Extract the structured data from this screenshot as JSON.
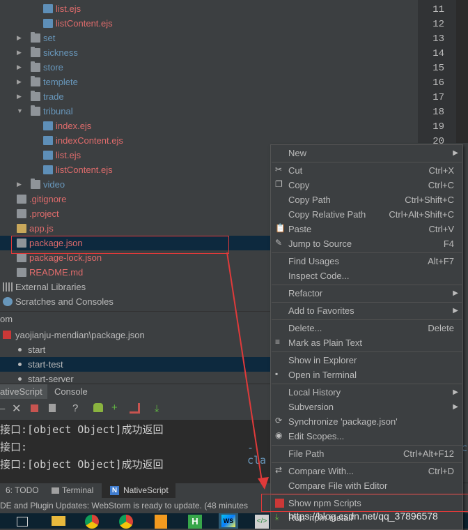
{
  "colors": {
    "accent_red": "#e03a3a",
    "selection": "#0d293e",
    "menu_bg": "#3c3f41"
  },
  "tree": {
    "items": [
      {
        "label": "list.ejs",
        "kind": "ejs",
        "indent": 3,
        "color": "red"
      },
      {
        "label": "listContent.ejs",
        "kind": "ejs",
        "indent": 3,
        "color": "red"
      },
      {
        "label": "set",
        "kind": "folder",
        "indent": 2,
        "color": "blue",
        "arrow": "▶"
      },
      {
        "label": "sickness",
        "kind": "folder",
        "indent": 2,
        "color": "blue",
        "arrow": "▶"
      },
      {
        "label": "store",
        "kind": "folder",
        "indent": 2,
        "color": "blue",
        "arrow": "▶"
      },
      {
        "label": "templete",
        "kind": "folder",
        "indent": 2,
        "color": "blue",
        "arrow": "▶"
      },
      {
        "label": "trade",
        "kind": "folder",
        "indent": 2,
        "color": "blue",
        "arrow": "▶"
      },
      {
        "label": "tribunal",
        "kind": "folder",
        "indent": 2,
        "color": "blue",
        "arrow": "▼"
      },
      {
        "label": "index.ejs",
        "kind": "ejs",
        "indent": 3,
        "color": "red"
      },
      {
        "label": "indexContent.ejs",
        "kind": "ejs",
        "indent": 3,
        "color": "red"
      },
      {
        "label": "list.ejs",
        "kind": "ejs",
        "indent": 3,
        "color": "red"
      },
      {
        "label": "listContent.ejs",
        "kind": "ejs",
        "indent": 3,
        "color": "red"
      },
      {
        "label": "video",
        "kind": "folder",
        "indent": 2,
        "color": "blue",
        "arrow": "▶"
      },
      {
        "label": ".gitignore",
        "kind": "gen",
        "indent": 1,
        "color": "red"
      },
      {
        "label": ".project",
        "kind": "gen",
        "indent": 1,
        "color": "red"
      },
      {
        "label": "app.js",
        "kind": "js",
        "indent": 1,
        "color": "red"
      },
      {
        "label": "package.json",
        "kind": "gen",
        "indent": 1,
        "color": "red",
        "selected": true
      },
      {
        "label": "package-lock.json",
        "kind": "gen",
        "indent": 1,
        "color": "red"
      },
      {
        "label": "README.md",
        "kind": "gen",
        "indent": 1,
        "color": "red"
      },
      {
        "label": "External Libraries",
        "kind": "lib",
        "indent": 0,
        "color": "white"
      },
      {
        "label": "Scratches and Consoles",
        "kind": "scratch",
        "indent": 0,
        "color": "white"
      }
    ]
  },
  "gutter": {
    "lines": [
      "11",
      "12",
      "13",
      "14",
      "15",
      "16",
      "17",
      "18",
      "19",
      "20"
    ]
  },
  "npm": {
    "header": "om",
    "file": "yaojianju-mendian\\package.json",
    "scripts": [
      "start",
      "start-test",
      "start-server"
    ]
  },
  "run": {
    "tabs": [
      "ativeScript",
      "Console"
    ],
    "console_lines": [
      "接口:[object Object]成功返回",
      "接口:",
      "接口:[object Object]成功返回"
    ],
    "console_tail": "-cla",
    "console_tail_right": "c"
  },
  "bottom": {
    "tabs": [
      "6: TODO",
      "Terminal",
      "NativeScript"
    ],
    "status": "DE and Plugin Updates: WebStorm is ready to update. (48 minutes",
    "watermark": "https://blog.csdn.net/qq_37896578"
  },
  "menu": {
    "items": [
      {
        "label": "New",
        "shortcut": "",
        "sub": true,
        "icon": ""
      },
      {
        "sep": true
      },
      {
        "label": "Cut",
        "shortcut": "Ctrl+X",
        "icon": "scissors-icon"
      },
      {
        "label": "Copy",
        "shortcut": "Ctrl+C",
        "icon": "copy-icon"
      },
      {
        "label": "Copy Path",
        "shortcut": "Ctrl+Shift+C",
        "icon": ""
      },
      {
        "label": "Copy Relative Path",
        "shortcut": "Ctrl+Alt+Shift+C",
        "icon": ""
      },
      {
        "label": "Paste",
        "shortcut": "Ctrl+V",
        "icon": "paste-icon"
      },
      {
        "label": "Jump to Source",
        "shortcut": "F4",
        "icon": "pencil-icon"
      },
      {
        "sep": true
      },
      {
        "label": "Find Usages",
        "shortcut": "Alt+F7",
        "icon": ""
      },
      {
        "label": "Inspect Code...",
        "shortcut": "",
        "icon": ""
      },
      {
        "sep": true
      },
      {
        "label": "Refactor",
        "shortcut": "",
        "sub": true,
        "icon": ""
      },
      {
        "sep": true
      },
      {
        "label": "Add to Favorites",
        "shortcut": "",
        "sub": true,
        "icon": ""
      },
      {
        "sep": true
      },
      {
        "label": "Delete...",
        "shortcut": "Delete",
        "icon": ""
      },
      {
        "label": "Mark as Plain Text",
        "shortcut": "",
        "icon": "plain-text-icon"
      },
      {
        "sep": true
      },
      {
        "label": "Show in Explorer",
        "shortcut": "",
        "icon": ""
      },
      {
        "label": "Open in Terminal",
        "shortcut": "",
        "icon": "terminal-icon"
      },
      {
        "sep": true
      },
      {
        "label": "Local History",
        "shortcut": "",
        "sub": true,
        "icon": ""
      },
      {
        "label": "Subversion",
        "shortcut": "",
        "sub": true,
        "icon": ""
      },
      {
        "label": "Synchronize 'package.json'",
        "shortcut": "",
        "icon": "sync-icon"
      },
      {
        "label": "Edit Scopes...",
        "shortcut": "",
        "icon": "scopes-icon"
      },
      {
        "sep": true
      },
      {
        "label": "File Path",
        "shortcut": "Ctrl+Alt+F12",
        "icon": ""
      },
      {
        "sep": true
      },
      {
        "label": "Compare With...",
        "shortcut": "Ctrl+D",
        "icon": "compare-icon"
      },
      {
        "label": "Compare File with Editor",
        "shortcut": "",
        "icon": ""
      },
      {
        "sep": true
      },
      {
        "label": "Show npm Scripts",
        "shortcut": "",
        "icon": "npm-icon",
        "highlight": true
      },
      {
        "label": "Run 'npm install'",
        "shortcut": "",
        "icon": "download-icon"
      }
    ]
  }
}
